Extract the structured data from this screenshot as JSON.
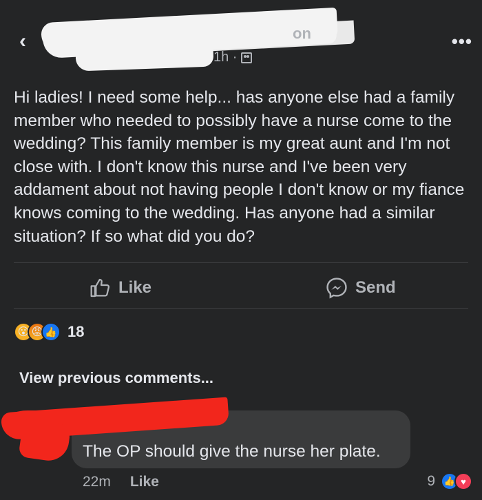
{
  "header": {
    "name_visible_fragment": "on",
    "time": "1h ·",
    "back_icon": "chevron-left-icon",
    "more_icon": "ellipsis-icon"
  },
  "post": {
    "text": "Hi ladies! I need some help... has anyone else had a family member who needed to possibly have a nurse come to the wedding? This family member is my great aunt and I'm not close with. I don't know this nurse and I've been very addament about not having people I don't know or my fiance knows coming to the wedding.  Has anyone had a similar situation? If so what did you do?"
  },
  "actions": {
    "like_label": "Like",
    "send_label": "Send"
  },
  "reactions": {
    "count": "18",
    "types": [
      "wow",
      "angry",
      "like"
    ]
  },
  "comments": {
    "view_previous": "View previous comments...",
    "items": [
      {
        "author_fragment": "",
        "text": "The OP should give the nurse her plate.",
        "time": "22m",
        "like_label": "Like",
        "reaction_count": "9",
        "reaction_types": [
          "like",
          "love"
        ]
      }
    ]
  },
  "colors": {
    "background": "#242526",
    "text": "#e4e6eb",
    "secondary": "#b0b3b8",
    "bubble": "#3a3b3c",
    "like_blue": "#1877f2",
    "love_red": "#f33e58"
  }
}
